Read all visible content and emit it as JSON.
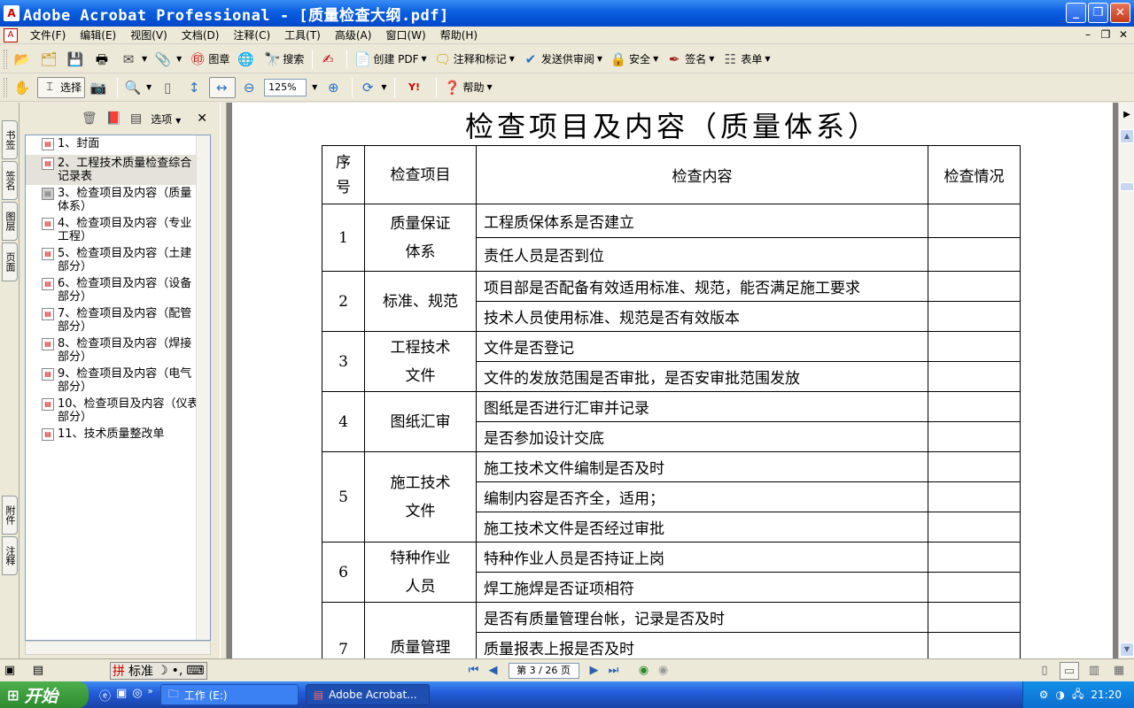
{
  "window": {
    "title": "Adobe Acrobat Professional - [质量检查大纲.pdf]",
    "app_icon": "acrobat-icon"
  },
  "menubar": {
    "items": [
      "文件(F)",
      "编辑(E)",
      "视图(V)",
      "文档(D)",
      "注释(C)",
      "工具(T)",
      "高级(A)",
      "窗口(W)",
      "帮助(H)"
    ]
  },
  "toolbar1": {
    "stamp": "图章",
    "search": "搜索",
    "create_pdf": "创建 PDF",
    "comment": "注释和标记",
    "review": "发送供审阅",
    "security": "安全",
    "sign": "签名",
    "forms": "表单"
  },
  "toolbar2": {
    "select": "选择",
    "zoom": "125%",
    "help": "帮助"
  },
  "side_tabs": [
    "书签",
    "签名",
    "图层",
    "页面",
    "附件",
    "注释"
  ],
  "bookmarks_panel": {
    "options": "选项",
    "items": [
      "1、封面",
      "2、工程技术质量检查综合记录表",
      "3、检查项目及内容（质量体系）",
      "4、检查项目及内容（专业工程）",
      "5、检查项目及内容（土建部分）",
      "6、检查项目及内容（设备部分）",
      "7、检查项目及内容（配管部分）",
      "8、检查项目及内容（焊接部分）",
      "9、检查项目及内容（电气部分）",
      "10、检查项目及内容（仪表部分）",
      "11、技术质量整改单"
    ],
    "selected_index": 1
  },
  "document": {
    "title": "检查项目及内容（质量体系）",
    "headers": {
      "no": "序号",
      "item": "检查项目",
      "content": "检查内容",
      "status": "检查情况"
    },
    "rows": [
      {
        "no": "1",
        "item": "质量保证体系",
        "contents": [
          "工程质保体系是否建立",
          "责任人员是否到位"
        ]
      },
      {
        "no": "2",
        "item": "标准、规范",
        "contents": [
          "项目部是否配备有效适用标准、规范，能否满足施工要求",
          "技术人员使用标准、规范是否有效版本"
        ]
      },
      {
        "no": "3",
        "item": "工程技术文件",
        "contents": [
          "文件是否登记",
          "文件的发放范围是否审批，是否安审批范围发放"
        ]
      },
      {
        "no": "4",
        "item": "图纸汇审",
        "contents": [
          "图纸是否进行汇审并记录",
          "是否参加设计交底"
        ]
      },
      {
        "no": "5",
        "item": "施工技术文件",
        "contents": [
          "施工技术文件编制是否及时",
          "编制内容是否齐全，适用；",
          "施工技术文件是否经过审批"
        ]
      },
      {
        "no": "6",
        "item": "特种作业人员",
        "contents": [
          "特种作业人员是否持证上岗",
          "焊工施焊是否证项相符"
        ]
      },
      {
        "no": "7",
        "item": "质量管理",
        "contents": [
          "是否有质量管理台帐，记录是否及时",
          "质量报表上报是否及时"
        ]
      }
    ]
  },
  "statusbar": {
    "page": "第 3 / 26 页",
    "ime_mode": "标准"
  },
  "taskbar": {
    "start": "开始",
    "tasks": [
      "工作 (E:)",
      "Adobe Acrobat..."
    ],
    "clock": "21:20"
  }
}
